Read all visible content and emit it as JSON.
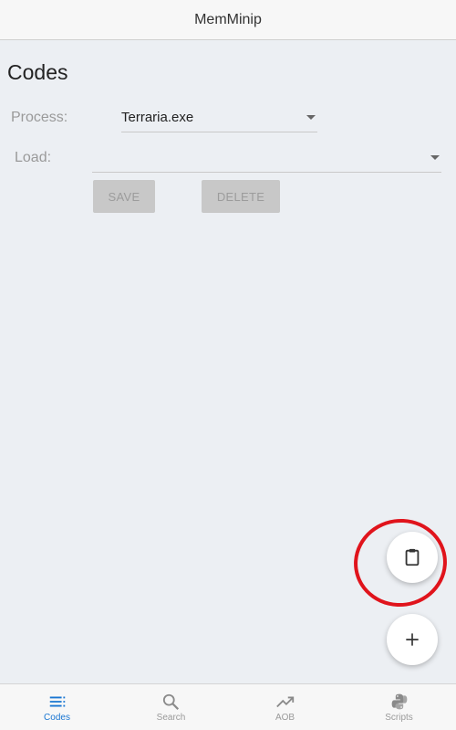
{
  "app": {
    "title": "MemMinip"
  },
  "page": {
    "title": "Codes"
  },
  "form": {
    "process_label": "Process:",
    "process_value": "Terraria.exe",
    "load_label": "Load:",
    "load_value": ""
  },
  "buttons": {
    "save_label": "SAVE",
    "delete_label": "DELETE"
  },
  "fabs": {
    "paste_icon": "clipboard-icon",
    "add_icon": "plus-icon"
  },
  "nav": {
    "items": [
      {
        "label": "Codes",
        "icon": "list-icon",
        "active": true
      },
      {
        "label": "Search",
        "icon": "search-icon",
        "active": false
      },
      {
        "label": "AOB",
        "icon": "trending-up-icon",
        "active": false
      },
      {
        "label": "Scripts",
        "icon": "python-icon",
        "active": false
      }
    ]
  },
  "colors": {
    "accent": "#1976d2",
    "highlight_ring": "#e0141c",
    "background": "#eceff3"
  }
}
